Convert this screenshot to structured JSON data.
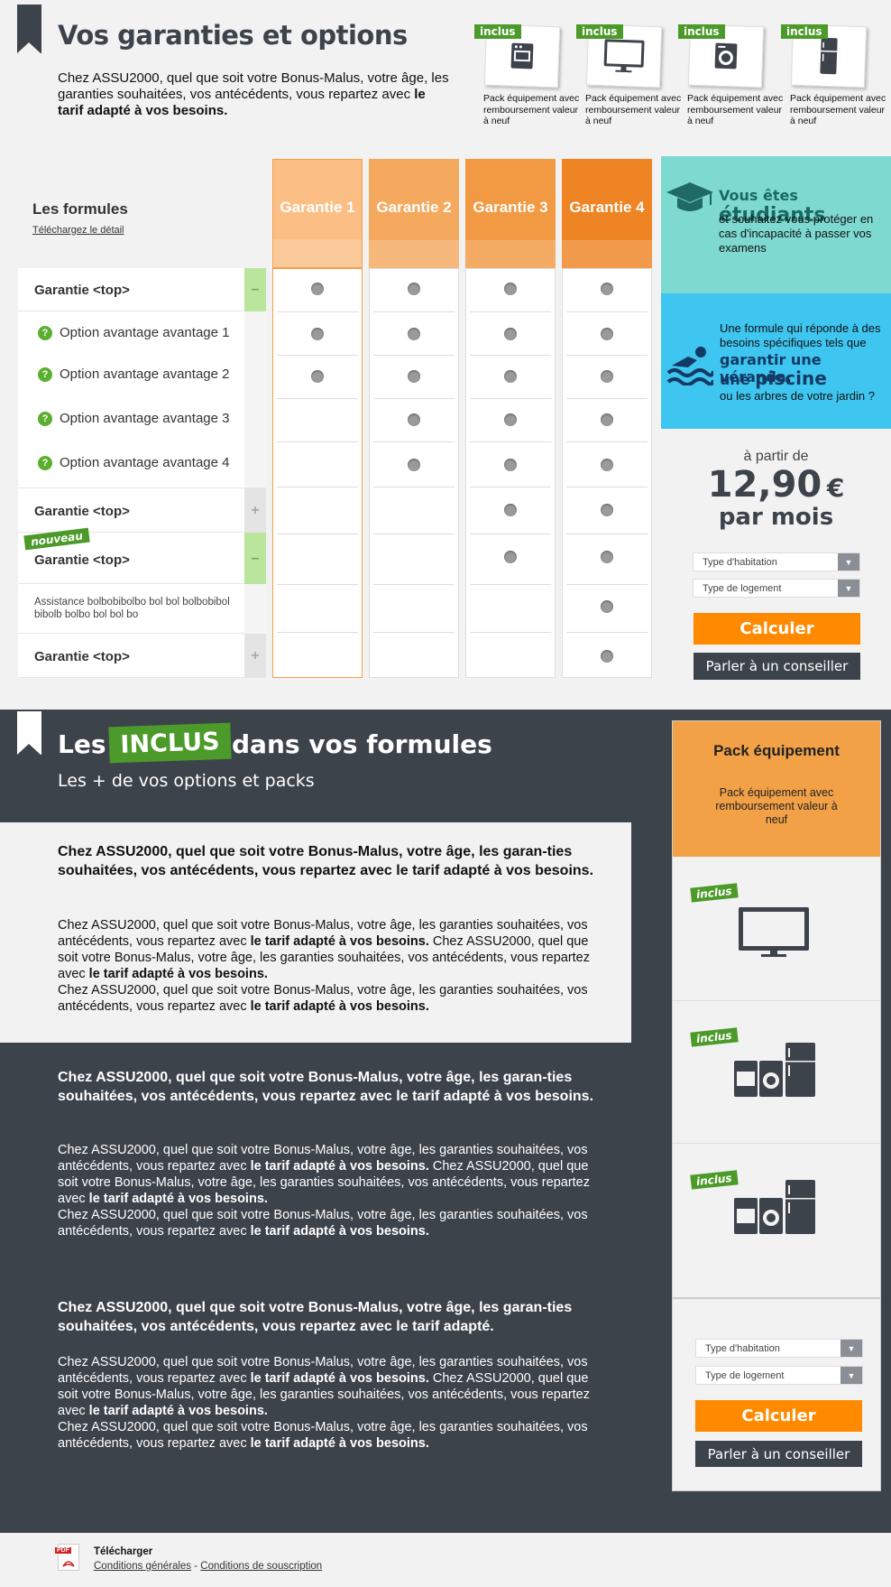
{
  "header": {
    "title": "Vos garanties et options",
    "intro_text": "Chez ASSU2000, quel que soit votre Bonus-Malus, votre âge, les garanties souhaitées, vos antécédents, vous repartez avec",
    "intro_bold": "le tarif adapté à vos besoins.",
    "packs": [
      {
        "tag": "inclus",
        "caption": "Pack équipement avec remboursement valeur à neuf",
        "icon": "oven-icon"
      },
      {
        "tag": "inclus",
        "caption": "Pack équipement avec remboursement valeur à neuf",
        "icon": "tv-icon"
      },
      {
        "tag": "inclus",
        "caption": "Pack équipement avec remboursement valeur à neuf",
        "icon": "washing-machine-icon"
      },
      {
        "tag": "inclus",
        "caption": "Pack équipement avec remboursement valeur à neuf",
        "icon": "fridge-icon"
      }
    ]
  },
  "formules": {
    "title": "Les formules",
    "download_link": "Téléchargez le détail",
    "columns": [
      "Garantie 1",
      "Garantie 2",
      "Garantie 3",
      "Garantie 4"
    ],
    "column_colors": [
      "#fbbf85",
      "#f5a95e",
      "#f29a43",
      "#ee8424"
    ],
    "rows": [
      {
        "label": "Garantie <top>",
        "type": "group",
        "toggle": "–",
        "dots": [
          true,
          true,
          true,
          true
        ]
      },
      {
        "label": "Option avantage avantage 1",
        "type": "option",
        "dots": [
          true,
          true,
          true,
          true
        ]
      },
      {
        "label": "Option avantage avantage 2",
        "type": "option",
        "dots": [
          true,
          true,
          true,
          true
        ]
      },
      {
        "label": "Option avantage avantage 3",
        "type": "option",
        "dots": [
          false,
          true,
          true,
          true
        ]
      },
      {
        "label": "Option avantage avantage 4",
        "type": "option",
        "dots": [
          false,
          true,
          true,
          true
        ]
      },
      {
        "label": "Garantie <top>",
        "type": "group",
        "toggle": "+",
        "dots": [
          false,
          false,
          true,
          true
        ]
      },
      {
        "label": "Garantie <top>",
        "type": "group",
        "toggle": "–",
        "badge": "nouveau",
        "dots": [
          false,
          false,
          true,
          true
        ]
      },
      {
        "label": "Assistance bolbobibolbo bol bol bolbobibol bibolb bolbo bol bol bo",
        "type": "sub",
        "dots": [
          false,
          false,
          false,
          true
        ]
      },
      {
        "label": "Garantie <top>",
        "type": "group",
        "toggle": "+",
        "dots": [
          false,
          false,
          false,
          true
        ]
      }
    ]
  },
  "promo": {
    "students_pre": "Vous êtes ",
    "students_big": "étudiants",
    "students_text": "et souhaitez vous protéger en cas d'incapacité à passer vos examens",
    "pool_text1": "Une formule qui réponde à des besoins spécifiques tels que",
    "pool_big1": "garantir une véranda",
    "pool_comma": ",",
    "pool_big2a": "une ",
    "pool_big2b": "piscine",
    "pool_text2": "ou les arbres de votre jardin ?",
    "price_from": "à partir de",
    "price": "12,90",
    "currency": "€",
    "per": "par mois",
    "select1": "Type d'habitation",
    "select2": "Type de logement",
    "calc_btn": "Calculer",
    "advisor_btn": "Parler à un conseiller"
  },
  "inclus": {
    "title_pre": "Les",
    "title_tag": "INCLUS",
    "title_post": "dans vos formules",
    "subtitle": "Les + de vos options et packs",
    "blocks": [
      {
        "headline": "Chez ASSU2000, quel que soit votre Bonus-Malus, votre âge, les garan-ties souhaitées, vos antécédents, vous repartez avec le tarif adapté à vos besoins.",
        "p1": "Chez ASSU2000, quel que soit votre Bonus-Malus, votre âge, les garanties souhaitées, vos antécédents, vous repartez avec ",
        "p1b": "le tarif adapté à vos besoins.",
        "p2": " Chez ASSU2000, quel que soit votre Bonus-Malus, votre âge, les garanties souhaitées, vos antécédents, vous repartez avec ",
        "p2b": "le tarif adapté à vos besoins.",
        "p3": "Chez ASSU2000, quel que soit votre Bonus-Malus, votre âge, les garanties souhaitées, vos antécédents, vous repartez avec ",
        "p3b": "le tarif adapté à vos besoins."
      },
      {
        "headline": "Chez ASSU2000, quel que soit votre Bonus-Malus, votre âge, les garan-ties souhaitées, vos antécédents, vous repartez avec le tarif adapté à vos besoins.",
        "p1": "Chez ASSU2000, quel que soit votre Bonus-Malus, votre âge, les garanties souhaitées, vos antécédents, vous repartez avec ",
        "p1b": "le tarif adapté à vos besoins.",
        "p2": " Chez ASSU2000, quel que soit votre Bonus-Malus, votre âge, les garanties souhaitées, vos antécédents, vous repartez avec ",
        "p2b": "le tarif adapté à vos besoins.",
        "p3": "Chez ASSU2000, quel que soit votre Bonus-Malus, votre âge, les garanties souhaitées, vos antécédents, vous repartez avec ",
        "p3b": "le tarif adapté à vos besoins."
      },
      {
        "headline": "Chez ASSU2000, quel que soit votre Bonus-Malus, votre âge, les garan-ties souhaitées, vos antécédents, vous repartez avec le tarif adapté.",
        "p1": "Chez ASSU2000, quel que soit votre Bonus-Malus, votre âge, les garanties souhaitées, vos antécédents, vous repartez avec ",
        "p1b": "le tarif adapté à vos besoins.",
        "p2": " Chez ASSU2000, quel que soit votre Bonus-Malus, votre âge, les garanties souhaitées, vos antécédents, vous repartez avec ",
        "p2b": "le tarif adapté à vos besoins.",
        "p3": "Chez ASSU2000, quel que soit votre Bonus-Malus, votre âge, les garanties souhaitées, vos antécédents, vous repartez avec ",
        "p3b": "le tarif adapté à vos besoins."
      }
    ],
    "pack": {
      "title": "Pack équipement",
      "text": "Pack équipement avec remboursement valeur à neuf"
    },
    "cards": [
      {
        "tag": "inclus",
        "icon": "tv-icon"
      },
      {
        "tag": "inclus",
        "icon": "appliances-icon"
      },
      {
        "tag": "inclus",
        "icon": "appliances-icon"
      }
    ],
    "select1": "Type d'habitation",
    "select2": "Type de logement",
    "calc_btn": "Calculer",
    "advisor_btn": "Parler à un conseiller"
  },
  "footer": {
    "title": "Télécharger",
    "link1": "Conditions générales",
    "sep": " - ",
    "link2": "Conditions de souscription",
    "pdf_label": "PDF"
  },
  "colors": {
    "accent_orange": "#ff8a00",
    "dark": "#3d434b",
    "green": "#4c9a2a",
    "teal": "#7ed9d0",
    "blue": "#3ec5f0"
  }
}
